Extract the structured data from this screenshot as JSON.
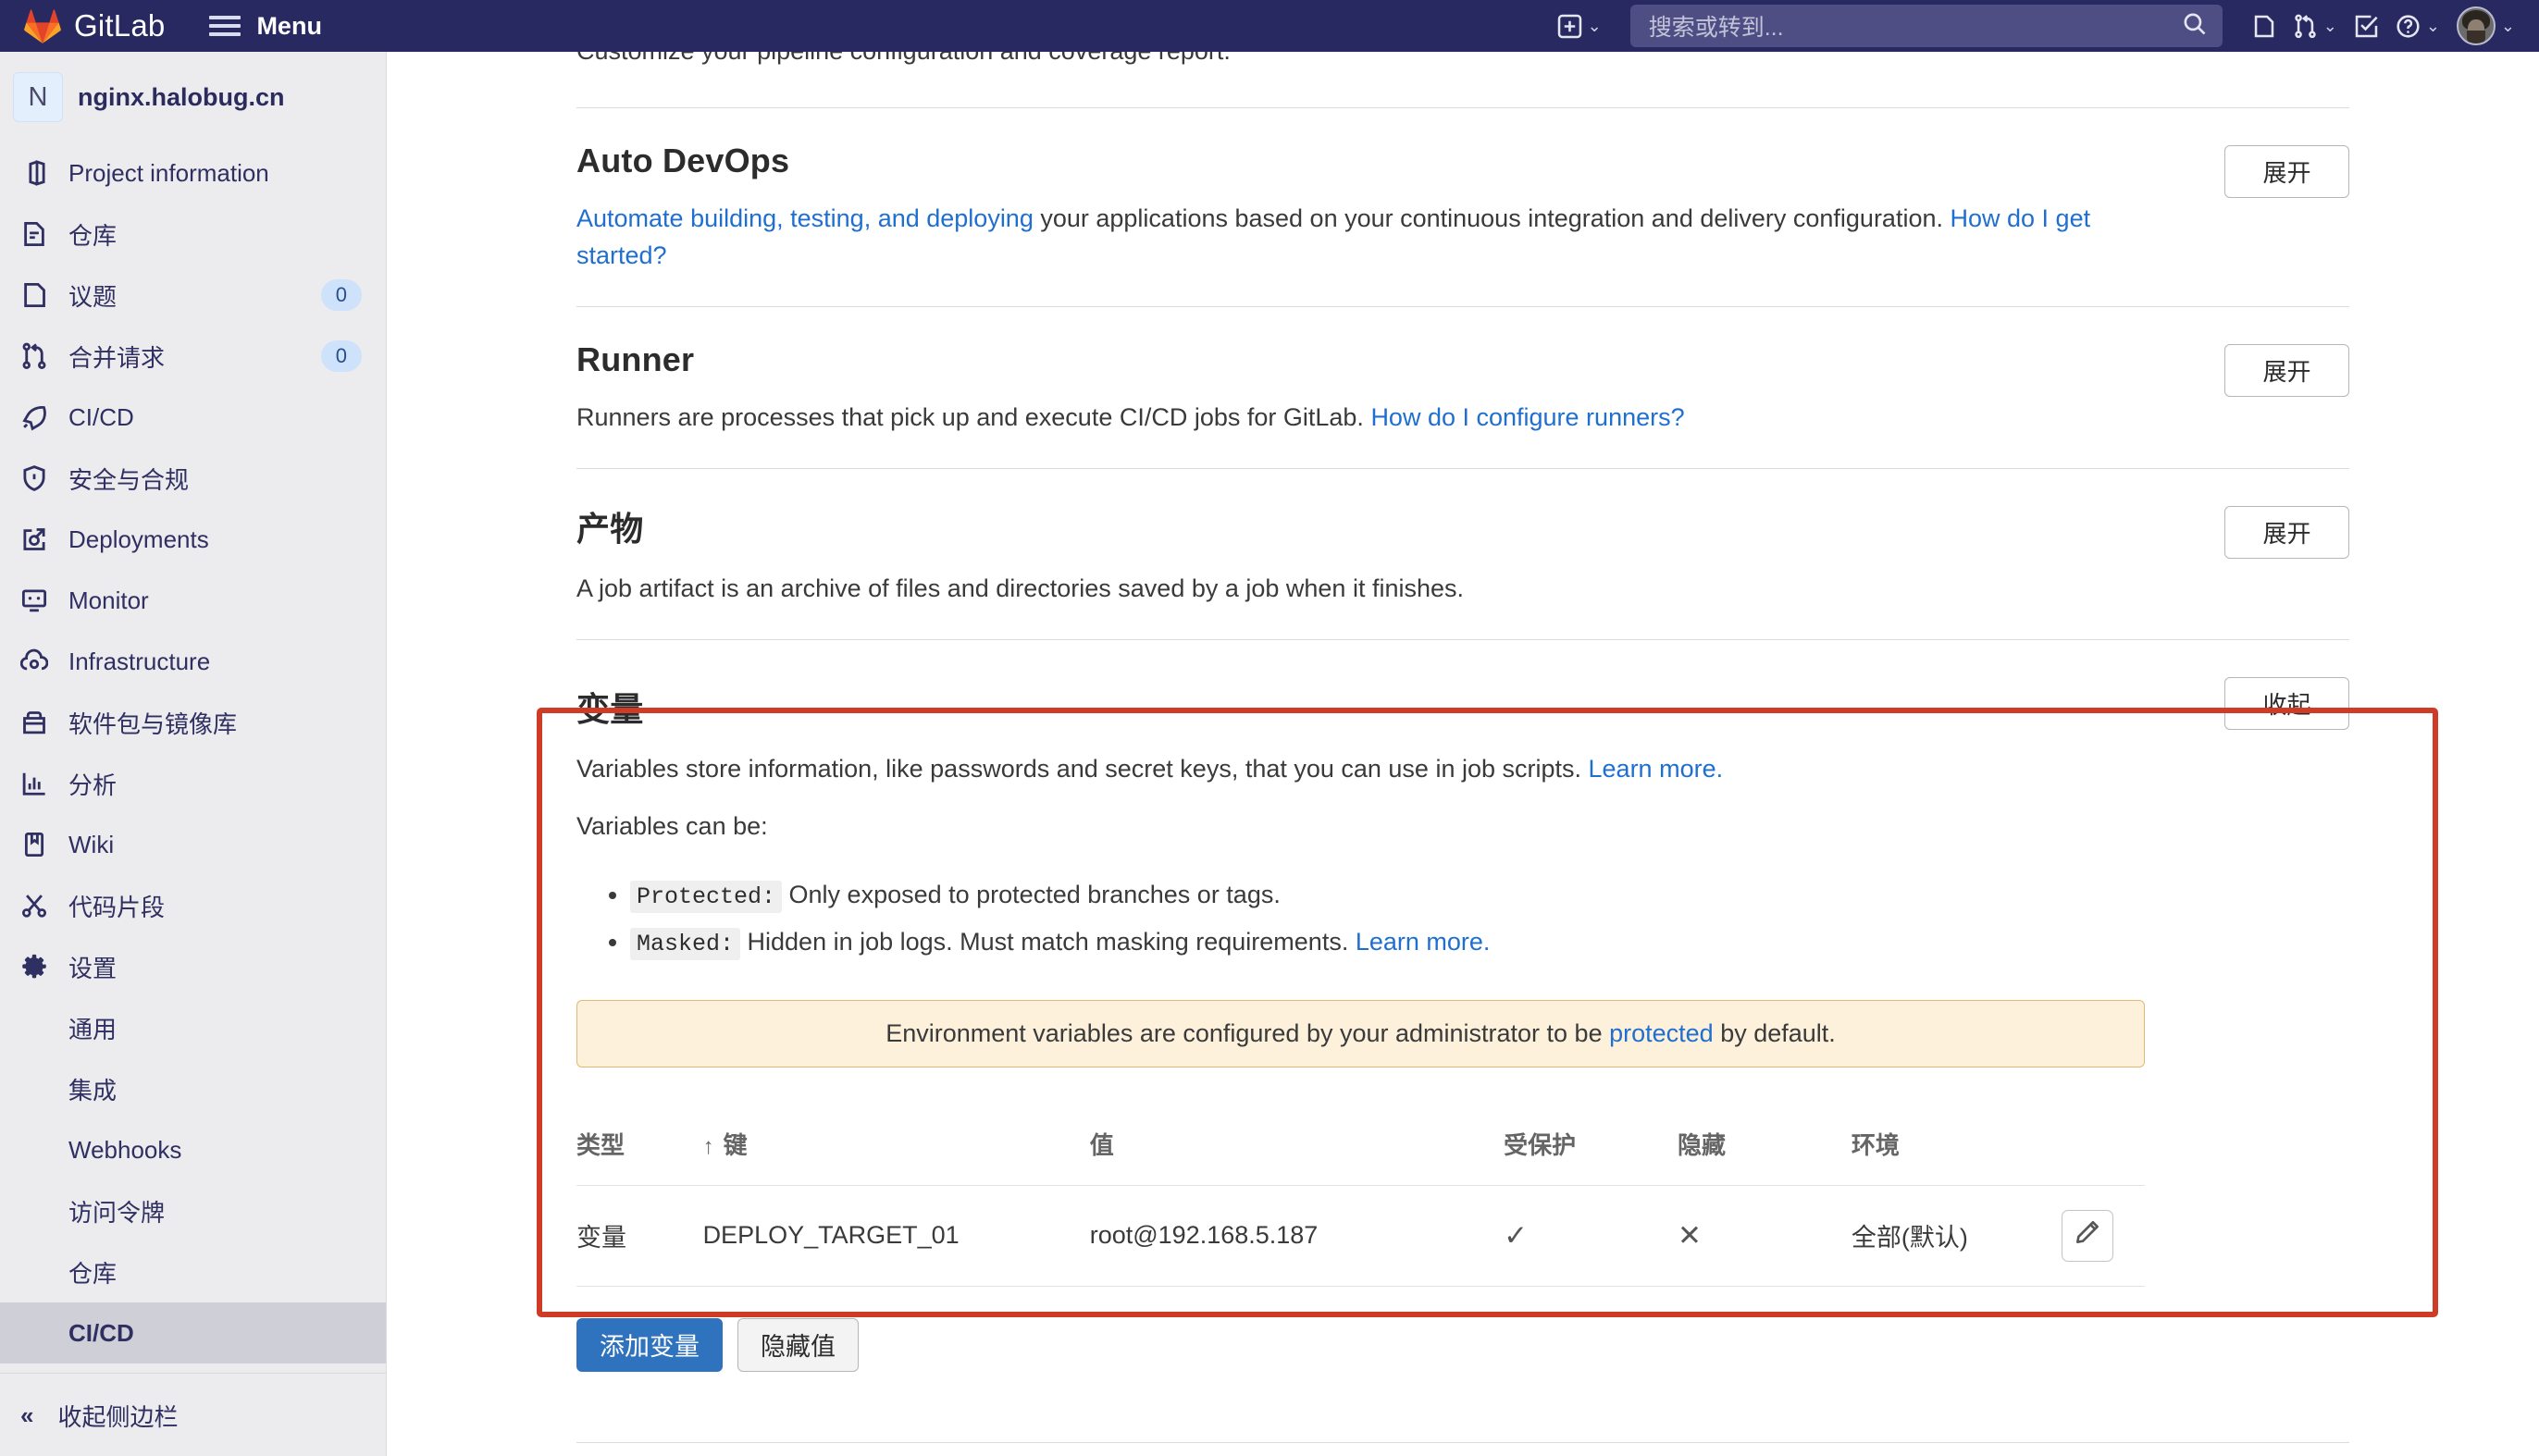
{
  "header": {
    "brand": "GitLab",
    "menu_label": "Menu",
    "brand_logo_icon": "gitlab-tanuki-logo",
    "hamburger_icon": "hamburger-menu-icon",
    "create_new_icon": "plus-square-icon",
    "search": {
      "placeholder": "搜索或转到...",
      "value": "",
      "icon": "search-icon"
    },
    "issues_icon": "issues-icon",
    "merge_requests_icon": "merge-request-icon",
    "todos_icon": "todo-check-icon",
    "help_icon": "question-circle-icon",
    "avatar_icon": "user-avatar",
    "caret_icon": "chevron-down-icon"
  },
  "sidebar": {
    "project": {
      "initial": "N",
      "name": "nginx.halobug.cn"
    },
    "items": [
      {
        "label": "Project information",
        "icon": "project-info-icon",
        "badge": ""
      },
      {
        "label": "仓库",
        "icon": "repository-icon",
        "badge": ""
      },
      {
        "label": "议题",
        "icon": "issues-icon",
        "badge": "0"
      },
      {
        "label": "合并请求",
        "icon": "merge-request-icon",
        "badge": "0"
      },
      {
        "label": "CI/CD",
        "icon": "rocket-icon",
        "badge": ""
      },
      {
        "label": "安全与合规",
        "icon": "shield-icon",
        "badge": ""
      },
      {
        "label": "Deployments",
        "icon": "deployments-icon",
        "badge": ""
      },
      {
        "label": "Monitor",
        "icon": "monitor-icon",
        "badge": ""
      },
      {
        "label": "Infrastructure",
        "icon": "cloud-gear-icon",
        "badge": ""
      },
      {
        "label": "软件包与镜像库",
        "icon": "package-icon",
        "badge": ""
      },
      {
        "label": "分析",
        "icon": "analytics-icon",
        "badge": ""
      },
      {
        "label": "Wiki",
        "icon": "wiki-book-icon",
        "badge": ""
      },
      {
        "label": "代码片段",
        "icon": "snippet-scissors-icon",
        "badge": ""
      },
      {
        "label": "设置",
        "icon": "gear-icon",
        "badge": ""
      }
    ],
    "settings_sub": [
      {
        "label": "通用",
        "active": false
      },
      {
        "label": "集成",
        "active": false
      },
      {
        "label": "Webhooks",
        "active": false
      },
      {
        "label": "访问令牌",
        "active": false
      },
      {
        "label": "仓库",
        "active": false
      },
      {
        "label": "CI/CD",
        "active": true
      }
    ],
    "collapse": {
      "label": "收起侧边栏",
      "icon": "double-chevron-left-icon"
    }
  },
  "main": {
    "clipped_text": "Customize your pipeline configuration and coverage report.",
    "sections": [
      {
        "title": "Auto DevOps",
        "expand_label": "展开",
        "body_pre": "",
        "link1": "Automate building, testing, and deploying",
        "body_mid": " your applications based on your continuous integration and delivery configuration. ",
        "link2": "How do I get started?",
        "body_post": ""
      },
      {
        "title": "Runner",
        "expand_label": "展开",
        "body_pre": "Runners are processes that pick up and execute CI/CD jobs for GitLab. ",
        "link1": "How do I configure runners?",
        "body_mid": "",
        "link2": "",
        "body_post": ""
      },
      {
        "title": "产物",
        "expand_label": "展开",
        "body_pre": "A job artifact is an archive of files and directories saved by a job when it finishes.",
        "link1": "",
        "body_mid": "",
        "link2": "",
        "body_post": ""
      }
    ],
    "variables": {
      "title": "变量",
      "collapse_label": "收起",
      "intro_text": "Variables store information, like passwords and secret keys, that you can use in job scripts. ",
      "intro_link": "Learn more.",
      "can_be_label": "Variables can be:",
      "bullets": [
        {
          "code": "Protected:",
          "text": " Only exposed to protected branches or tags.",
          "link": ""
        },
        {
          "code": "Masked:",
          "text": " Hidden in job logs. Must match masking requirements. ",
          "link": "Learn more."
        }
      ],
      "alert_pre": "Environment variables are configured by your administrator to be ",
      "alert_link": "protected",
      "alert_post": " by default.",
      "table": {
        "columns": [
          "类型",
          "键",
          "值",
          "受保护",
          "隐藏",
          "环境",
          ""
        ],
        "sort_arrow": "↑",
        "sorted_column_index": 1,
        "rows": [
          {
            "type": "变量",
            "key": "DEPLOY_TARGET_01",
            "value": "root@192.168.5.187",
            "protected": "✓",
            "masked": "✕",
            "environment": "全部(默认)",
            "edit_icon": "pencil-edit-icon"
          }
        ]
      },
      "add_button": "添加变量",
      "hide_values_button": "隐藏值"
    }
  },
  "annotation": {
    "color": "#ce3c27",
    "shape": "rectangle-highlight"
  }
}
